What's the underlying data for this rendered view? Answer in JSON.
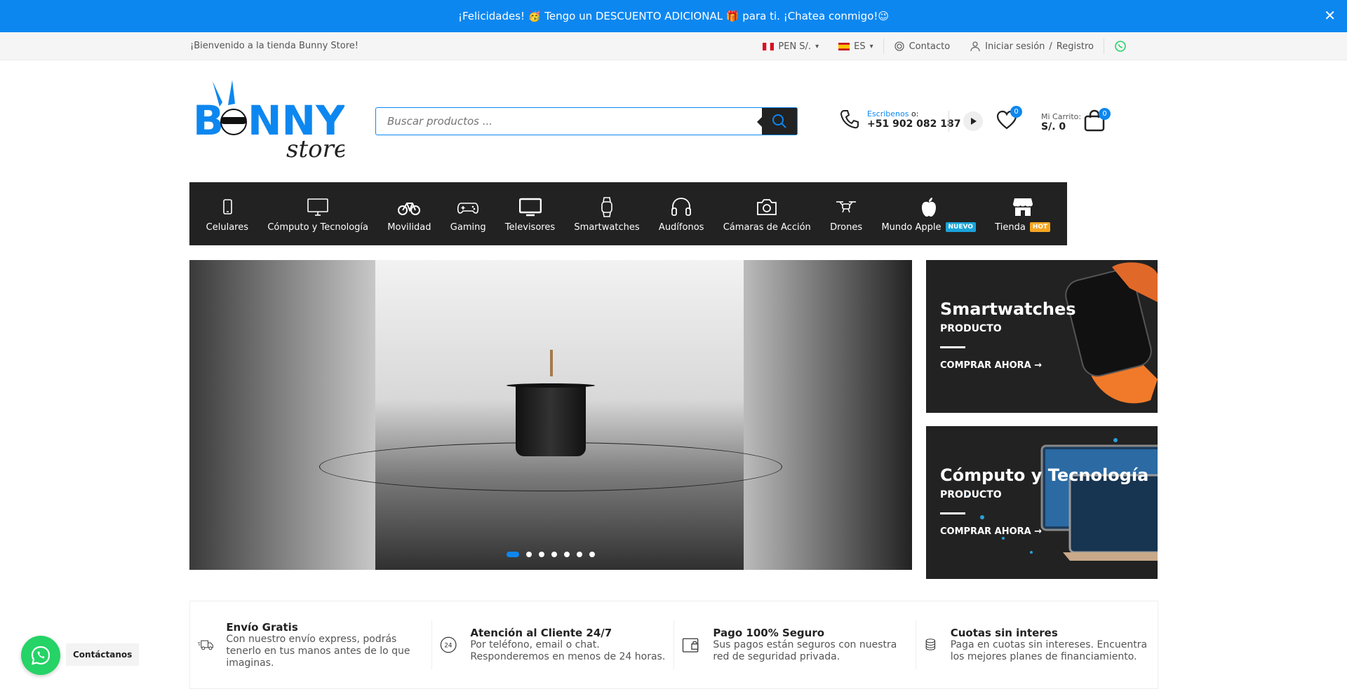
{
  "promo_bar": {
    "text": "¡Felicidades! 🥳 Tengo un DESCUENTO ADICIONAL 🎁 para ti. ¡Chatea conmigo!😉",
    "close": "✕"
  },
  "topbar": {
    "welcome": "¡Bienvenido a la tienda Bunny Store!",
    "currency": "PEN S/.",
    "language": "ES",
    "contact": "Contacto",
    "login": "Iniciar sesión",
    "divider": "/",
    "register": "Registro"
  },
  "header": {
    "search_placeholder": "Buscar productos ...",
    "phone_prefix": "Escribenos",
    "phone_suffix": "o:",
    "phone_number": "+51 902 082 187",
    "wishlist_count": "0",
    "cart_label": "Mi Carrito:",
    "cart_total": "S/. 0",
    "cart_count": "0"
  },
  "nav": {
    "items": [
      {
        "label": "Celulares"
      },
      {
        "label": "Cómputo y Tecnología"
      },
      {
        "label": "Movilidad"
      },
      {
        "label": "Gaming"
      },
      {
        "label": "Televisores"
      },
      {
        "label": "Smartwatches"
      },
      {
        "label": "Audífonos"
      },
      {
        "label": "Cámaras de Acción"
      },
      {
        "label": "Drones"
      },
      {
        "label": "Mundo Apple",
        "tag": "NUEVO"
      },
      {
        "label": "Tienda",
        "tag": "HOT"
      }
    ]
  },
  "cards": [
    {
      "title": "Smartwatches",
      "subtitle": "PRODUCTO",
      "cta": "COMPRAR AHORA"
    },
    {
      "title": "Cómputo y Tecnología",
      "subtitle": "PRODUCTO",
      "cta": "COMPRAR AHORA"
    }
  ],
  "features": [
    {
      "title": "Envío Gratis",
      "desc": "Con nuestro envío express, podrás tenerlo en tus manos antes de lo que imaginas."
    },
    {
      "title": "Atención al Cliente 24/7",
      "desc": "Por teléfono, email o chat. Responderemos en menos de 24 horas."
    },
    {
      "title": "Pago 100% Seguro",
      "desc": "Sus pagos están seguros con nuestra red de seguridad privada."
    },
    {
      "title": "Cuotas sin interes",
      "desc": "Paga en cuotas sin intereses. Encuentra los mejores planes de financiamiento."
    }
  ],
  "chat": {
    "label": "Contáctanos"
  },
  "colors": {
    "accent": "#0d87f0",
    "nav_bg": "#222222",
    "whatsapp": "#25d366"
  }
}
